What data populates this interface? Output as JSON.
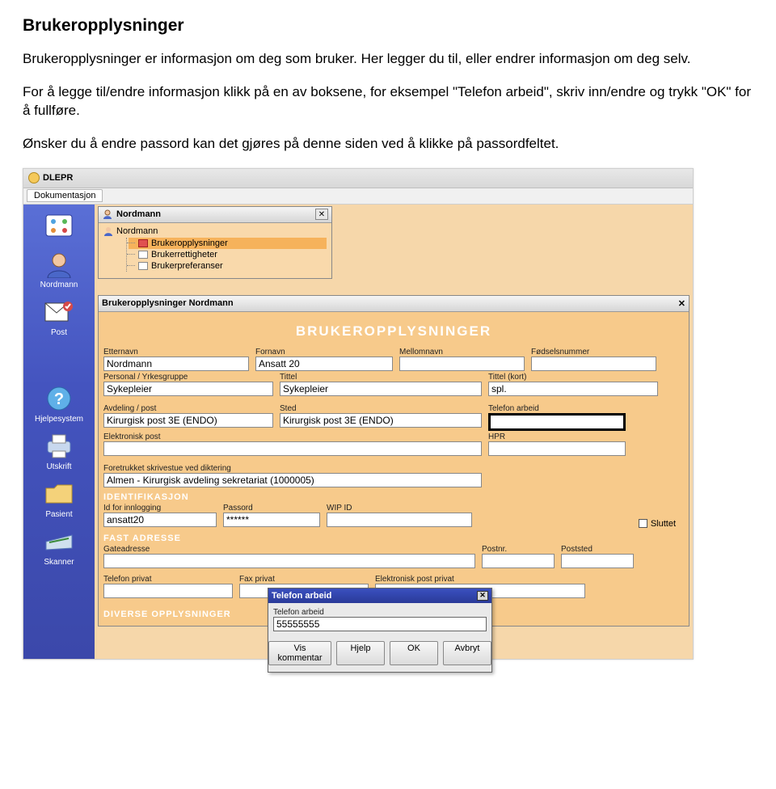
{
  "doc": {
    "title": "Brukeropplysninger",
    "para1": "Brukeropplysninger er informasjon om deg som bruker. Her legger du til, eller endrer informasjon om deg selv.",
    "para2": "For å legge til/endre informasjon klikk på en av boksene, for eksempel \"Telefon arbeid\", skriv inn/endre og trykk \"OK\" for å fullføre.",
    "para3": "Ønsker du å endre passord kan det gjøres på denne siden ved å klikke på passordfeltet."
  },
  "app": {
    "title": "DLEPR",
    "doc_tab": "Dokumentasjon"
  },
  "sidebar": {
    "items": [
      {
        "label": "",
        "icon": "modules-icon"
      },
      {
        "label": "Nordmann",
        "icon": "person-icon"
      },
      {
        "label": "Post",
        "icon": "mail-icon"
      },
      {
        "label": "",
        "icon": "blank-icon"
      },
      {
        "label": "Hjelpesystem",
        "icon": "help-icon"
      },
      {
        "label": "Utskrift",
        "icon": "printer-icon"
      },
      {
        "label": "Pasient",
        "icon": "folder-icon"
      },
      {
        "label": "Skanner",
        "icon": "scanner-icon"
      }
    ]
  },
  "tree": {
    "window_title": "Nordmann",
    "root": "Nordmann",
    "items": [
      {
        "label": "Brukeropplysninger",
        "selected": true
      },
      {
        "label": "Brukerrettigheter",
        "selected": false
      },
      {
        "label": "Brukerpreferanser",
        "selected": false
      }
    ]
  },
  "form": {
    "window_title": "Brukeropplysninger  Nordmann",
    "heading": "BRUKEROPPLYSNINGER",
    "row1": [
      {
        "label": "Etternavn",
        "value": "Nordmann"
      },
      {
        "label": "Fornavn",
        "value": "Ansatt 20"
      },
      {
        "label": "Mellomnavn",
        "value": ""
      },
      {
        "label": "Fødselsnummer",
        "value": ""
      }
    ],
    "row2": [
      {
        "label": "Personal / Yrkesgruppe",
        "value": "Sykepleier"
      },
      {
        "label": "Tittel",
        "value": "Sykepleier"
      },
      {
        "label": "Tittel (kort)",
        "value": "spl."
      }
    ],
    "row3": [
      {
        "label": "Avdeling / post",
        "value": "Kirurgisk post 3E (ENDO)"
      },
      {
        "label": "Sted",
        "value": "Kirurgisk post 3E (ENDO)"
      },
      {
        "label": "Telefon arbeid",
        "value": "",
        "highlight": true
      }
    ],
    "row4": [
      {
        "label": "Elektronisk post",
        "value": ""
      },
      {
        "label": "HPR",
        "value": ""
      }
    ],
    "row5": {
      "label": "Foretrukket skrivestue ved diktering",
      "value": "Almen - Kirurgisk avdeling sekretariat (1000005)"
    },
    "section_ident": "IDENTIFIKASJON",
    "ident": [
      {
        "label": "Id for innlogging",
        "value": "ansatt20"
      },
      {
        "label": "Passord",
        "value": "******"
      },
      {
        "label": "WIP ID",
        "value": ""
      }
    ],
    "sluttet_label": "Sluttet",
    "section_addr": "FAST ADRESSE",
    "addr": [
      {
        "label": "Gateadresse",
        "value": ""
      },
      {
        "label": "Postnr.",
        "value": ""
      },
      {
        "label": "Poststed",
        "value": ""
      }
    ],
    "contact": [
      {
        "label": "Telefon privat",
        "value": ""
      },
      {
        "label": "Fax privat",
        "value": ""
      },
      {
        "label": "Elektronisk post privat",
        "value": ""
      }
    ],
    "section_div": "DIVERSE OPPLYSNINGER"
  },
  "dialog": {
    "title": "Telefon arbeid",
    "field_label": "Telefon arbeid",
    "field_value": "55555555",
    "buttons": {
      "kommentar": "Vis kommentar",
      "help": "Hjelp",
      "ok": "OK",
      "cancel": "Avbryt"
    }
  }
}
